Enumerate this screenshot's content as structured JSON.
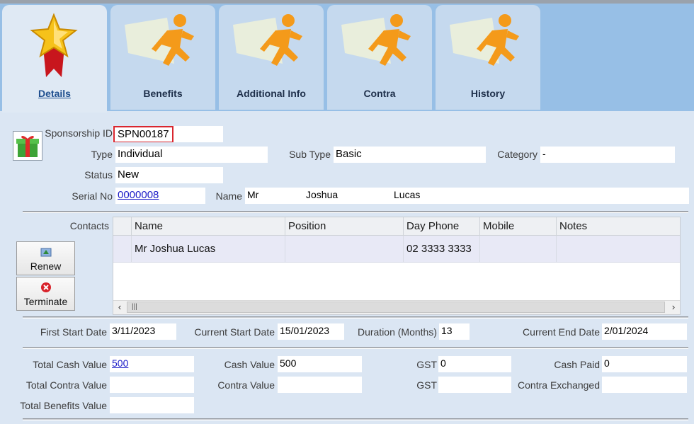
{
  "tabs": [
    {
      "label": "Details",
      "icon": "star-ribbon-icon",
      "active": true
    },
    {
      "label": "Benefits",
      "icon": "running-man-icon"
    },
    {
      "label": "Additional Info",
      "icon": "running-man-icon"
    },
    {
      "label": "Contra",
      "icon": "running-man-icon"
    },
    {
      "label": "History",
      "icon": "running-man-icon"
    }
  ],
  "header": {
    "sponsorship_id_label": "Sponsorship ID",
    "sponsorship_id": "SPN00187",
    "type_label": "Type",
    "type": "Individual",
    "sub_type_label": "Sub Type",
    "sub_type": "Basic",
    "category_label": "Category",
    "category": "-",
    "status_label": "Status",
    "status": "New",
    "serial_label": "Serial No",
    "serial": "0000008",
    "name_label": "Name",
    "name_title": "Mr",
    "name_first": "Joshua",
    "name_last": "Lucas"
  },
  "contacts": {
    "label": "Contacts",
    "columns": [
      "Name",
      "Position",
      "Day Phone",
      "Mobile",
      "Notes"
    ],
    "rows": [
      [
        "Mr Joshua Lucas",
        "",
        "02 3333 3333",
        "",
        ""
      ]
    ],
    "renew_label": "Renew",
    "terminate_label": "Terminate"
  },
  "dates": {
    "first_start_label": "First Start Date",
    "first_start": "3/11/2023",
    "current_start_label": "Current Start Date",
    "current_start": "15/01/2023",
    "duration_label": "Duration (Months)",
    "duration": "13",
    "current_end_label": "Current End Date",
    "current_end": "2/01/2024"
  },
  "totals": {
    "total_cash_label": "Total Cash Value",
    "total_cash": "500",
    "cash_value_label": "Cash Value",
    "cash_value": "500",
    "gst1_label": "GST",
    "gst1": "0",
    "cash_paid_label": "Cash Paid",
    "cash_paid": "0",
    "total_contra_label": "Total Contra Value",
    "total_contra": "",
    "contra_value_label": "Contra Value",
    "contra_value": "",
    "gst2_label": "GST",
    "gst2": "",
    "contra_exchanged_label": "Contra Exchanged",
    "contra_exchanged": "",
    "total_benefits_label": "Total Benefits Value",
    "total_benefits": ""
  },
  "colors": {
    "highlight_border": "#d9262e",
    "link": "#1d1dc8",
    "tabstrip": "#97bfe6",
    "panel": "#dbe6f3"
  }
}
